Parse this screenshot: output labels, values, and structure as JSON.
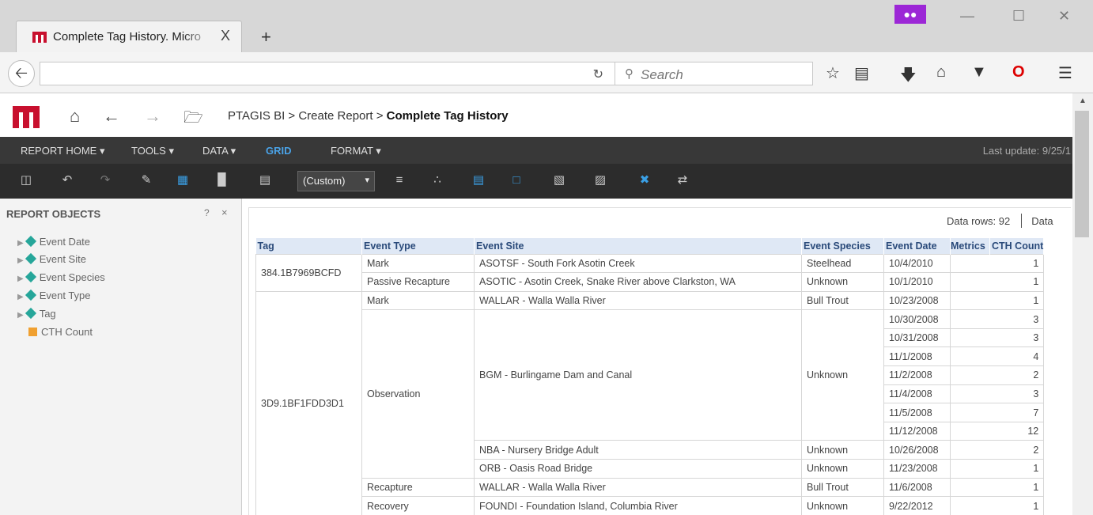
{
  "browser": {
    "tab_title": "Complete Tag History. Micro",
    "tab_close": "X",
    "new_tab": "+",
    "search_placeholder": "Search",
    "mask_icon": "mask-icon"
  },
  "app": {
    "breadcrumb_prefix": "PTAGIS BI > Create Report >",
    "breadcrumb_current": "Complete Tag History",
    "menu": [
      "REPORT HOME",
      "TOOLS",
      "DATA",
      "GRID",
      "FORMAT"
    ],
    "active_menu": "GRID",
    "last_update": "Last update: 9/25/1",
    "toolbar_select": "(Custom)",
    "brand_color": "#c8102e"
  },
  "objects_panel": {
    "title": "REPORT OBJECTS",
    "help": "?",
    "close": "×",
    "attributes": [
      "Event Date",
      "Event Site",
      "Event Species",
      "Event Type",
      "Tag"
    ],
    "metrics": [
      "CTH Count"
    ]
  },
  "report": {
    "data_rows": "Data rows: 92",
    "data_cut": "Data",
    "columns": [
      "Tag",
      "Event Type",
      "Event Site",
      "Event Species",
      "Event Date",
      "Metrics",
      "CTH Count"
    ],
    "rows": [
      {
        "tag": "384.1B7969BCFD",
        "type": "Mark",
        "site": "ASOTSF - South Fork Asotin Creek",
        "species": "Steelhead",
        "date": "10/4/2010",
        "count": "1"
      },
      {
        "type": "Passive Recapture",
        "site": "ASOTIC - Asotin Creek, Snake River above Clarkston, WA",
        "species": "Unknown",
        "date": "10/1/2010",
        "count": "1"
      },
      {
        "tag": "3D9.1BF1FDD3D1",
        "type": "Mark",
        "site": "WALLAR - Walla Walla River",
        "species": "Bull Trout",
        "date": "10/23/2008",
        "count": "1"
      },
      {
        "type": "Observation",
        "site": "BGM - Burlingame Dam and Canal",
        "species": "Unknown",
        "date": "10/30/2008",
        "count": "3"
      },
      {
        "date": "10/31/2008",
        "count": "3"
      },
      {
        "date": "11/1/2008",
        "count": "4"
      },
      {
        "date": "11/2/2008",
        "count": "2"
      },
      {
        "date": "11/4/2008",
        "count": "3"
      },
      {
        "date": "11/5/2008",
        "count": "7"
      },
      {
        "date": "11/12/2008",
        "count": "12"
      },
      {
        "site": "NBA - Nursery Bridge Adult",
        "species": "Unknown",
        "date": "10/26/2008",
        "count": "2"
      },
      {
        "site": "ORB - Oasis Road Bridge",
        "species": "Unknown",
        "date": "11/23/2008",
        "count": "1"
      },
      {
        "type": "Recapture",
        "site": "WALLAR - Walla Walla River",
        "species": "Bull Trout",
        "date": "11/6/2008",
        "count": "1"
      },
      {
        "type": "Recovery",
        "site": "FOUNDI - Foundation Island, Columbia River",
        "species": "Unknown",
        "date": "9/22/2012",
        "count": "1"
      }
    ]
  }
}
